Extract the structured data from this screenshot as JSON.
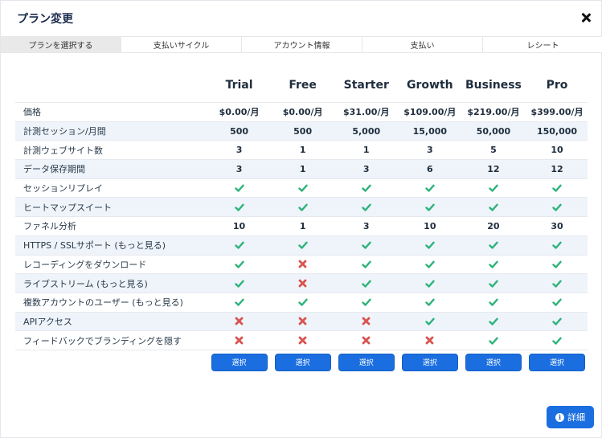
{
  "modal": {
    "title": "プラン変更",
    "close_icon": "close-icon"
  },
  "tabs": [
    {
      "label": "プランを選択する",
      "active": true
    },
    {
      "label": "支払いサイクル",
      "active": false
    },
    {
      "label": "アカウント情報",
      "active": false
    },
    {
      "label": "支払い",
      "active": false
    },
    {
      "label": "レシート",
      "active": false
    }
  ],
  "plans": [
    "Trial",
    "Free",
    "Starter",
    "Growth",
    "Business",
    "Pro"
  ],
  "rows": [
    {
      "label": "価格",
      "values": [
        "$0.00/月",
        "$0.00/月",
        "$31.00/月",
        "$109.00/月",
        "$219.00/月",
        "$399.00/月"
      ]
    },
    {
      "label": "計測セッション/月間",
      "values": [
        "500",
        "500",
        "5,000",
        "15,000",
        "50,000",
        "150,000"
      ]
    },
    {
      "label": "計測ウェブサイト数",
      "values": [
        "3",
        "1",
        "1",
        "3",
        "5",
        "10"
      ]
    },
    {
      "label": "データ保存期間",
      "values": [
        "3",
        "1",
        "3",
        "6",
        "12",
        "12"
      ]
    },
    {
      "label": "セッションリプレイ",
      "values": [
        "check",
        "check",
        "check",
        "check",
        "check",
        "check"
      ]
    },
    {
      "label": "ヒートマップスイート",
      "values": [
        "check",
        "check",
        "check",
        "check",
        "check",
        "check"
      ]
    },
    {
      "label": "ファネル分析",
      "values": [
        "10",
        "1",
        "3",
        "10",
        "20",
        "30"
      ]
    },
    {
      "label": "HTTPS / SSLサポート (もっと見る)",
      "values": [
        "check",
        "check",
        "check",
        "check",
        "check",
        "check"
      ]
    },
    {
      "label": "レコーディングをダウンロード",
      "values": [
        "check",
        "cross",
        "check",
        "check",
        "check",
        "check"
      ]
    },
    {
      "label": "ライブストリーム (もっと見る)",
      "values": [
        "check",
        "cross",
        "check",
        "check",
        "check",
        "check"
      ]
    },
    {
      "label": "複数アカウントのユーザー (もっと見る)",
      "values": [
        "check",
        "check",
        "check",
        "check",
        "check",
        "check"
      ]
    },
    {
      "label": "APIアクセス",
      "values": [
        "cross",
        "cross",
        "cross",
        "check",
        "check",
        "check"
      ]
    },
    {
      "label": "フィードバックでブランディングを隠す",
      "values": [
        "cross",
        "cross",
        "cross",
        "cross",
        "check",
        "check"
      ]
    }
  ],
  "select_label": "選択",
  "detail_button": {
    "label": "詳細",
    "icon": "info-icon"
  },
  "colors": {
    "check": "#2db37a",
    "cross": "#d9534f",
    "accent": "#1a6ee0",
    "row_alt": "#eef4fa"
  }
}
